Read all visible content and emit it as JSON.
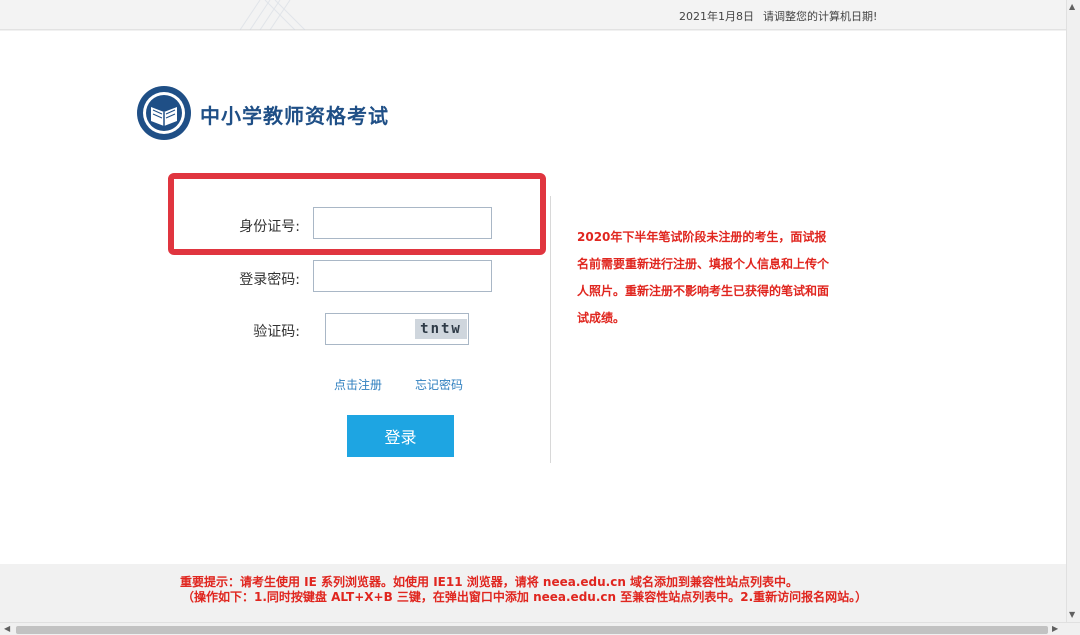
{
  "topbar": {
    "date": "2021年1月8日",
    "message": "请调整您的计算机日期!"
  },
  "header": {
    "title": "中小学教师资格考试",
    "logo_icon": "book-emblem-icon"
  },
  "form": {
    "id_label": "身份证号:",
    "id_value": "",
    "password_label": "登录密码:",
    "password_value": "",
    "captcha_label": "验证码:",
    "captcha_value": "",
    "captcha_text": "tntw",
    "register_link": "点击注册",
    "forgot_link": "忘记密码",
    "login_button": "登录"
  },
  "notice": {
    "text": "2020年下半年笔试阶段未注册的考生，面试报名前需要重新进行注册、填报个人信息和上传个人照片。重新注册不影响考生已获得的笔试和面试成绩。"
  },
  "footer": {
    "line1": "重要提示：请考生使用 IE 系列浏览器。如使用 IE11 浏览器，请将 neea.edu.cn 域名添加到兼容性站点列表中。",
    "line2": "（操作如下：1.同时按键盘 ALT+X+B 三键，在弹出窗口中添加 neea.edu.cn 至兼容性站点列表中。2.重新访问报名网站。）"
  },
  "colors": {
    "brand_blue": "#1f4f86",
    "button_blue": "#1ea5e2",
    "notice_red": "#e0261f",
    "highlight_red": "#e0353f"
  }
}
